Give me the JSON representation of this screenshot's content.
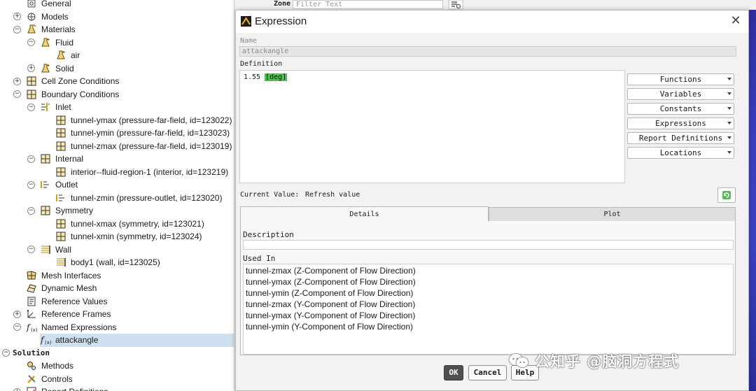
{
  "tree": {
    "items": [
      {
        "label": "General",
        "level": 1,
        "icon": "settings-icon",
        "toggle": "none"
      },
      {
        "label": "Models",
        "level": 1,
        "icon": "models-icon",
        "toggle": "plus"
      },
      {
        "label": "Materials",
        "level": 1,
        "icon": "materials-icon",
        "toggle": "minus"
      },
      {
        "label": "Fluid",
        "level": 2,
        "icon": "flask-icon",
        "toggle": "minus"
      },
      {
        "label": "air",
        "level": 3,
        "icon": "flask-icon",
        "toggle": "none"
      },
      {
        "label": "Solid",
        "level": 2,
        "icon": "flask-icon",
        "toggle": "plus"
      },
      {
        "label": "Cell Zone Conditions",
        "level": 1,
        "icon": "grid-icon",
        "toggle": "plus"
      },
      {
        "label": "Boundary Conditions",
        "level": 1,
        "icon": "grid-icon",
        "toggle": "minus"
      },
      {
        "label": "Inlet",
        "level": 2,
        "icon": "inlet-icon",
        "toggle": "minus"
      },
      {
        "label": "tunnel-ymax (pressure-far-field, id=123022)",
        "level": 3,
        "icon": "boundary-icon",
        "toggle": "none"
      },
      {
        "label": "tunnel-ymin (pressure-far-field, id=123023)",
        "level": 3,
        "icon": "boundary-icon",
        "toggle": "none"
      },
      {
        "label": "tunnel-zmax (pressure-far-field, id=123019)",
        "level": 3,
        "icon": "boundary-icon",
        "toggle": "none"
      },
      {
        "label": "Internal",
        "level": 2,
        "icon": "grid-icon",
        "toggle": "minus"
      },
      {
        "label": "interior--fluid-region-1 (interior, id=123219)",
        "level": 3,
        "icon": "boundary-icon",
        "toggle": "none"
      },
      {
        "label": "Outlet",
        "level": 2,
        "icon": "outlet-icon",
        "toggle": "minus"
      },
      {
        "label": "tunnel-zmin (pressure-outlet, id=123020)",
        "level": 3,
        "icon": "outlet-icon",
        "toggle": "none"
      },
      {
        "label": "Symmetry",
        "level": 2,
        "icon": "grid-icon",
        "toggle": "minus"
      },
      {
        "label": "tunnel-xmax (symmetry, id=123021)",
        "level": 3,
        "icon": "boundary-icon",
        "toggle": "none"
      },
      {
        "label": "tunnel-xmin (symmetry, id=123024)",
        "level": 3,
        "icon": "boundary-icon",
        "toggle": "none"
      },
      {
        "label": "Wall",
        "level": 2,
        "icon": "wall-icon",
        "toggle": "minus"
      },
      {
        "label": "body1 (wall, id=123025)",
        "level": 3,
        "icon": "wall-icon",
        "toggle": "none"
      },
      {
        "label": "Mesh Interfaces",
        "level": 1,
        "icon": "mesh-interfaces-icon",
        "toggle": "none"
      },
      {
        "label": "Dynamic Mesh",
        "level": 1,
        "icon": "dynamic-mesh-icon",
        "toggle": "none"
      },
      {
        "label": "Reference Values",
        "level": 1,
        "icon": "reference-values-icon",
        "toggle": "none"
      },
      {
        "label": "Reference Frames",
        "level": 1,
        "icon": "axes-icon",
        "toggle": "plus"
      },
      {
        "label": "Named Expressions",
        "level": 1,
        "icon": "function-icon",
        "toggle": "minus"
      },
      {
        "label": "attackangle",
        "level": 2,
        "icon": "function-icon",
        "toggle": "none",
        "selected": true
      },
      {
        "label": "Solution",
        "level": 0,
        "icon": "none",
        "toggle": "minus",
        "section": true
      },
      {
        "label": "Methods",
        "level": 1,
        "icon": "methods-icon",
        "toggle": "none"
      },
      {
        "label": "Controls",
        "level": 1,
        "icon": "controls-icon",
        "toggle": "none"
      },
      {
        "label": "Report Definitions",
        "level": 1,
        "icon": "report-icon",
        "toggle": "plus"
      }
    ]
  },
  "background": {
    "zone_label": "Zone",
    "zone_filter_placeholder": "Filter Text"
  },
  "dialog": {
    "title": "Expression",
    "name_label": "Name",
    "name_value": "attackangle",
    "definition_label": "Definition",
    "definition_number": "1.55",
    "definition_unit": "[deg]",
    "dropdowns": [
      "Functions",
      "Variables",
      "Constants",
      "Expressions",
      "Report Definitions",
      "Locations"
    ],
    "current_value_label": "Current Value:",
    "current_value": "Refresh value",
    "tabs": {
      "details": "Details",
      "plot": "Plot"
    },
    "description_label": "Description",
    "used_in_label": "Used In",
    "used_in": [
      "tunnel-zmax (Z-Component of Flow Direction)",
      "tunnel-ymax (Z-Component of Flow Direction)",
      "tunnel-ymin (Z-Component of Flow Direction)",
      "tunnel-zmax (Y-Component of Flow Direction)",
      "tunnel-ymax (Y-Component of Flow Direction)",
      "tunnel-ymin (Y-Component of Flow Direction)"
    ],
    "buttons": {
      "ok": "OK",
      "cancel": "Cancel",
      "help": "Help"
    }
  },
  "watermark": "公知乎 @脑洞方程式",
  "colors": {
    "selection": "#cfe0f1",
    "unit_highlight": "#4ec24e",
    "ok_button": "#4f4f4f",
    "viewport": "#3a3cc0"
  }
}
